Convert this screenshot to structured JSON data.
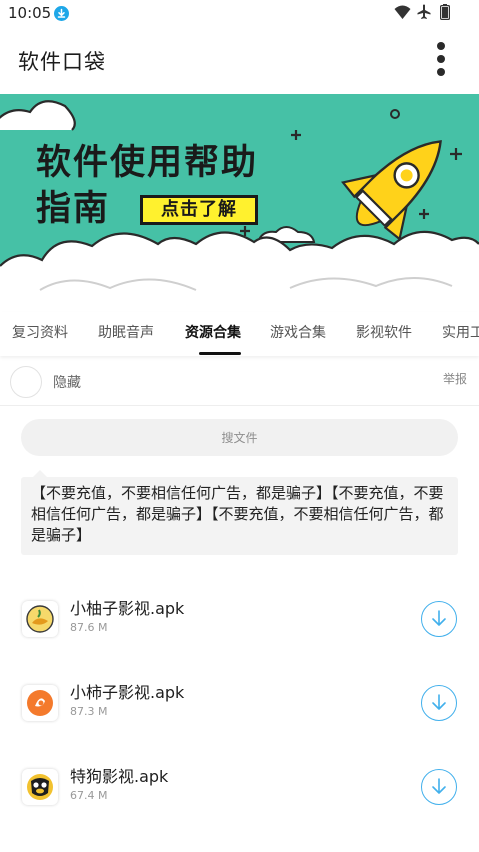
{
  "status_bar": {
    "time": "10:05",
    "icons": [
      "download-icon",
      "wifi-icon",
      "airplane-icon",
      "battery-icon"
    ]
  },
  "app_bar": {
    "title": "软件口袋",
    "more_icon": "more-vert-icon"
  },
  "banner": {
    "title_line1": "软件使用帮助",
    "title_line2": "指南",
    "button_label": "点击了解",
    "colors": {
      "background": "#46c1a6",
      "button": "#fff12e",
      "rocket": "#ffd21a"
    }
  },
  "tabs": {
    "items": [
      "复习资料",
      "助眠音声",
      "资源合集",
      "游戏合集",
      "影视软件",
      "实用工具"
    ],
    "active_index": 2
  },
  "folder": {
    "hidden_label": "隐藏",
    "report_label": "举报"
  },
  "search": {
    "placeholder": "搜文件"
  },
  "notice": {
    "text": "【不要充值，不要相信任何广告，都是骗子】【不要充值，不要相信任何广告，都是骗子】【不要充值，不要相信任何广告，都是骗子】"
  },
  "files": [
    {
      "name": "小柚子影视.apk",
      "size": "87.6 M",
      "icon": "grapefruit-app-icon"
    },
    {
      "name": "小柿子影视.apk",
      "size": "87.3 M",
      "icon": "persimmon-app-icon"
    },
    {
      "name": "特狗影视.apk",
      "size": "67.4 M",
      "icon": "dog-app-icon"
    }
  ],
  "accent_color": "#42b0ec"
}
